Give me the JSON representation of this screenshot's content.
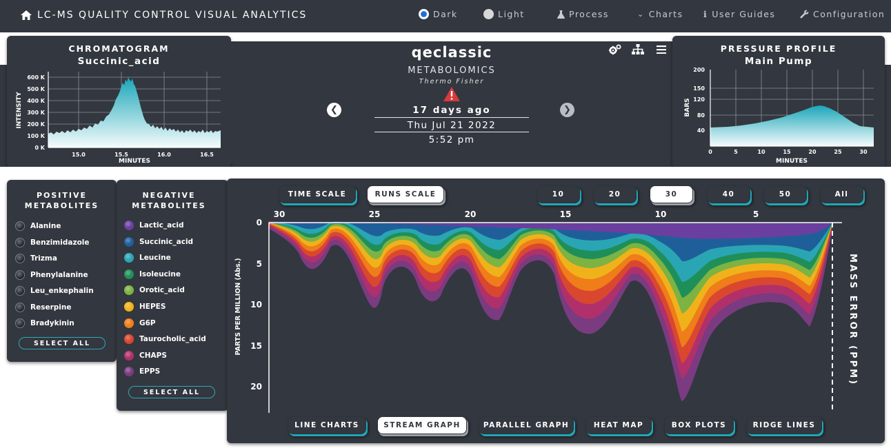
{
  "nav": {
    "title": "LC-MS QUALITY CONTROL VISUAL ANALYTICS",
    "dark_label": "Dark",
    "light_label": "Light",
    "process_label": "Process",
    "charts_label": "Charts",
    "guides_label": "User Guides",
    "config_label": "Configuration"
  },
  "chromatogram": {
    "title": "CHROMATOGRAM",
    "compound": "Succinic_acid",
    "ylabel": "INTENSITY",
    "xlabel": "MINUTES",
    "yticks": [
      "600 K",
      "500 K",
      "400 K",
      "300 K",
      "200 K",
      "100 K",
      "0 K"
    ],
    "xticks": [
      "15.0",
      "15.5",
      "16.0",
      "16.5"
    ]
  },
  "pressure": {
    "title": "PRESSURE PROFILE",
    "pump": "Main Pump",
    "ylabel": "BARS",
    "xlabel": "MINUTES",
    "yticks": [
      "200",
      "150",
      "120",
      "80",
      "40"
    ],
    "xticks": [
      "0",
      "5",
      "10",
      "15",
      "20",
      "25",
      "30"
    ]
  },
  "instrument": {
    "name": "qeclassic",
    "type": "METABOLOMICS",
    "maker": "Thermo Fisher",
    "ago": "17 days ago",
    "date": "Thu Jul 21 2022",
    "time": "5:52 pm"
  },
  "positive": {
    "title_line1": "POSITIVE",
    "title_line2": "METABOLITES",
    "items": [
      "Alanine",
      "Benzimidazole",
      "Trizma",
      "Phenylalanine",
      "Leu_enkephalin",
      "Reserpine",
      "Bradykinin"
    ],
    "select_all": "SELECT ALL"
  },
  "negative": {
    "title_line1": "NEGATIVE",
    "title_line2": "METABOLITES",
    "items": [
      "Lactic_acid",
      "Succinic_acid",
      "Leucine",
      "Isoleucine",
      "Orotic_acid",
      "HEPES",
      "G6P",
      "Taurocholic_acid",
      "CHAPS",
      "EPPS"
    ],
    "colors": [
      "#6a3fa0",
      "#1f5f99",
      "#2aa5b4",
      "#1f8f5a",
      "#7cb342",
      "#f0b21b",
      "#ef7d1a",
      "#d9472f",
      "#b0306c",
      "#7a3b80"
    ],
    "select_all": "SELECT ALL"
  },
  "controls": {
    "time_scale": "TIME SCALE",
    "runs_scale": "RUNS SCALE",
    "run_counts": [
      "10",
      "20",
      "30",
      "40",
      "50",
      "All"
    ]
  },
  "stream": {
    "ylabel": "PARTS PER MILLION (Abs.)",
    "side_label": "MASS ERROR (PPM)",
    "xticks": [
      "30",
      "25",
      "20",
      "15",
      "10",
      "5"
    ],
    "yticks": [
      "0",
      "5",
      "10",
      "15",
      "20"
    ]
  },
  "views": {
    "line_charts": "LINE CHARTS",
    "stream_graph": "STREAM GRAPH",
    "parallel_graph": "PARALLEL GRAPH",
    "heat_map": "HEAT MAP",
    "box_plots": "BOX PLOTS",
    "ridge_lines": "RIDGE LINES"
  }
}
